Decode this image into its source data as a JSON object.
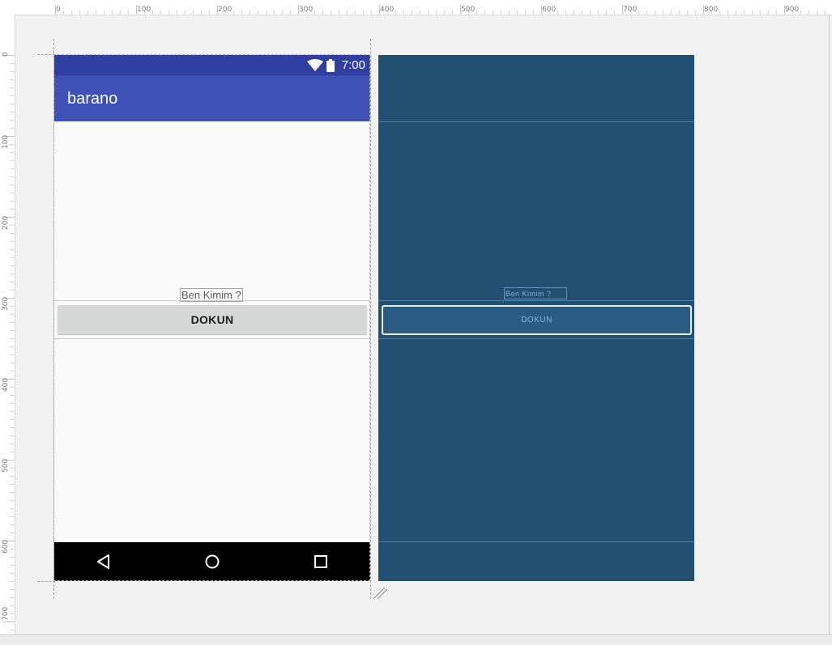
{
  "ruler": {
    "top_labels": [
      "0",
      "100",
      "200",
      "300",
      "400",
      "500",
      "600",
      "700",
      "800",
      "900"
    ],
    "left_labels": [
      "0",
      "100",
      "200",
      "300",
      "400",
      "500",
      "600",
      "700"
    ]
  },
  "device": {
    "status_time": "7:00",
    "app_title": "barano",
    "label_text": "Ben Kimim ?",
    "button_text": "DOKUN"
  },
  "blueprint": {
    "label_text": "Ben Kimim ?",
    "button_text": "DOKUN"
  },
  "colors": {
    "status_bar": "#303f9f",
    "app_bar": "#3f51b5",
    "blueprint_bg": "#234f70",
    "button": "#d6d7d7",
    "nav_bar": "#000000"
  },
  "icons": {
    "status": [
      "wifi-icon",
      "battery-icon"
    ],
    "nav": [
      "back-icon",
      "home-icon",
      "recents-icon"
    ]
  }
}
